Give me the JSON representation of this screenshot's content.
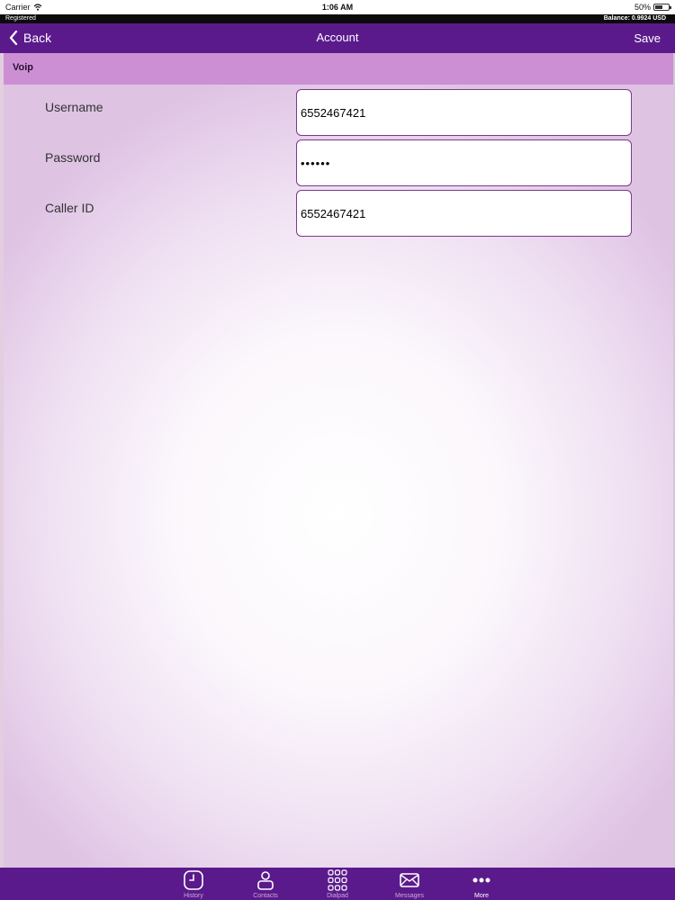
{
  "status_bar": {
    "carrier": "Carrier",
    "time": "1:06 AM",
    "battery": "50%"
  },
  "info_strip": {
    "registration": "Registered",
    "balance": "Balance: 0.9924 USD"
  },
  "nav": {
    "back_label": "Back",
    "title": "Account",
    "save_label": "Save"
  },
  "section": {
    "title": "Voip"
  },
  "form": {
    "username_label": "Username",
    "username_value": "6552467421",
    "password_label": "Password",
    "password_value": "••••••",
    "caller_id_label": "Caller ID",
    "caller_id_value": "6552467421"
  },
  "tabs": [
    {
      "label": "History",
      "icon": "clock-icon"
    },
    {
      "label": "Contacts",
      "icon": "person-icon"
    },
    {
      "label": "Dialpad",
      "icon": "dialpad-icon"
    },
    {
      "label": "Messages",
      "icon": "envelope-icon"
    },
    {
      "label": "More",
      "icon": "more-icon"
    }
  ],
  "colors": {
    "nav_purple": "#5b1a8c",
    "section_pink": "#cc8fd4",
    "field_border": "#7a3a8a"
  }
}
